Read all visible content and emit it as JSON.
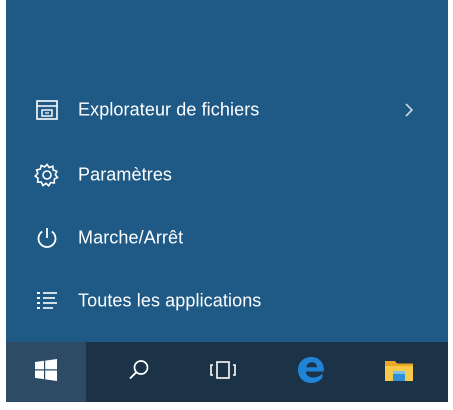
{
  "start_menu": {
    "items": [
      {
        "label": "Explorateur de fichiers",
        "icon": "file-explorer-icon",
        "has_submenu": true
      },
      {
        "label": "Paramètres",
        "icon": "gear-icon"
      },
      {
        "label": "Marche/Arrêt",
        "icon": "power-icon"
      },
      {
        "label": "Toutes les applications",
        "icon": "all-apps-icon"
      }
    ]
  },
  "taskbar": {
    "buttons": [
      {
        "name": "start",
        "icon": "windows-logo-icon"
      },
      {
        "name": "search",
        "icon": "search-icon"
      },
      {
        "name": "task-view",
        "icon": "task-view-icon"
      },
      {
        "name": "edge",
        "icon": "edge-icon"
      },
      {
        "name": "file-explorer",
        "icon": "folder-icon"
      }
    ]
  },
  "colors": {
    "menu_background": "#1f5a86",
    "taskbar_background": "#1c3247",
    "start_button_background": "#2e4b66",
    "edge_blue": "#1f84d6",
    "folder_yellow": "#f7c948"
  }
}
